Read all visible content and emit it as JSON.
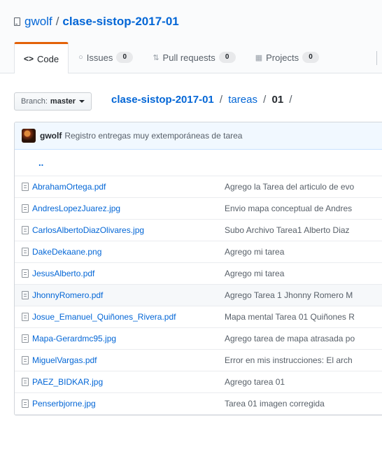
{
  "header": {
    "owner": "gwolf",
    "separator": "/",
    "repo": "clase-sistop-2017-01"
  },
  "tabs": [
    {
      "label": "Code",
      "icon": "code-icon"
    },
    {
      "label": "Issues",
      "icon": "issue-icon",
      "count": "0"
    },
    {
      "label": "Pull requests",
      "icon": "pull-request-icon",
      "count": "0"
    },
    {
      "label": "Projects",
      "icon": "project-icon",
      "count": "0"
    }
  ],
  "branch": {
    "prefix": "Branch:",
    "name": "master"
  },
  "breadcrumb": {
    "repo": "clase-sistop-2017-01",
    "dir": "tareas",
    "current": "01",
    "sep": "/"
  },
  "commit": {
    "author": "gwolf",
    "message": "Registro entregas muy extemporáneas de tarea"
  },
  "parent_link": "..",
  "files": [
    {
      "name": "AbrahamOrtega.pdf",
      "message": "Agrego la Tarea del articulo de evo"
    },
    {
      "name": "AndresLopezJuarez.jpg",
      "message": "Envio mapa conceptual de Andres"
    },
    {
      "name": "CarlosAlbertoDiazOlivares.jpg",
      "message": "Subo Archivo Tarea1 Alberto Diaz"
    },
    {
      "name": "DakeDekaane.png",
      "message": "Agrego mi tarea"
    },
    {
      "name": "JesusAlberto.pdf",
      "message": "Agrego mi tarea"
    },
    {
      "name": "JhonnyRomero.pdf",
      "message": "Agrego Tarea 1 Jhonny Romero M"
    },
    {
      "name": "Josue_Emanuel_Quiñones_Rivera.pdf",
      "message": "Mapa mental Tarea 01 Quiñones R"
    },
    {
      "name": "Mapa-Gerardmc95.jpg",
      "message": "Agrego tarea de mapa atrasada po"
    },
    {
      "name": "MiguelVargas.pdf",
      "message": "Error en mis instrucciones: El arch"
    },
    {
      "name": "PAEZ_BIDKAR.jpg",
      "message": "Agrego tarea 01"
    },
    {
      "name": "Penserbjorne.jpg",
      "message": "Tarea 01 imagen corregida"
    }
  ],
  "colors": {
    "link": "#0366d6",
    "tab_accent": "#e36209",
    "commit_bar": "#f1f8ff"
  }
}
